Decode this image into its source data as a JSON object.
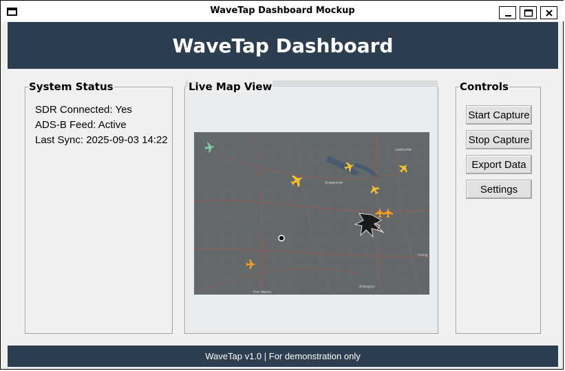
{
  "window": {
    "title": "WaveTap Dashboard Mockup",
    "icons": [
      "window-menu-icon",
      "minimize-icon",
      "maximize-icon",
      "close-icon"
    ]
  },
  "header": {
    "title": "WaveTap Dashboard"
  },
  "system_status": {
    "title": "System Status",
    "lines": [
      "SDR Connected: Yes",
      "ADS-B Feed: Active",
      "Last Sync: 2025-09-03 14:22"
    ]
  },
  "map_view": {
    "title": "Live Map View",
    "labels": [
      "Lewisville",
      "Irving",
      "Fort Worth",
      "Arlington",
      "Grapevine"
    ]
  },
  "controls": {
    "title": "Controls",
    "buttons": [
      "Start Capture",
      "Stop Capture",
      "Export Data",
      "Settings"
    ]
  },
  "footer": {
    "text": "WaveTap v1.0 | For demonstration only"
  },
  "colors": {
    "header_bg": "#2c3e50",
    "footer_bg": "#2c3e50",
    "header_text": "#ffffff",
    "aircraft_yellow": "#f2c230",
    "aircraft_orange": "#f0a020",
    "aircraft_green": "#7fd0a8"
  }
}
